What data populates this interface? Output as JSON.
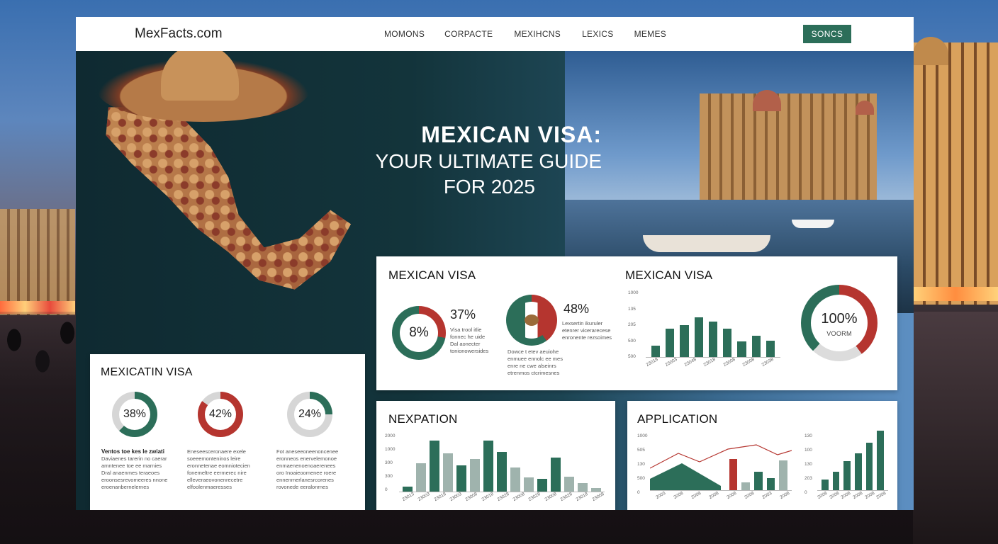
{
  "site": {
    "logo": "MexFacts.com",
    "nav": [
      "MOMONS",
      "CORPACTE",
      "MEXIHCNS",
      "LEXICS",
      "MEMES"
    ],
    "cta_label": "SONCS"
  },
  "hero": {
    "title_line1": "MEXICAN VISA:",
    "title_line2": "YOUR ULTIMATE GUIDE",
    "title_line3": "FOR 2025"
  },
  "card_top": {
    "title_left": "MEXICAN VISA",
    "donut1_value": "8%",
    "stat1_value": "37%",
    "stat1_text": [
      "Visa trool itlie",
      "fonnec he uide",
      "Dal aonecter",
      "tonionowersides"
    ],
    "stat2_value": "48%",
    "stat2_text": [
      "Lexsertin ikuruler",
      "etenrer vicerarecese",
      "enronente rezsoimes"
    ],
    "bottom_text": [
      "Dowce t etev aeuiohe",
      "enmuee ennolc ee mes",
      "enre ne cwe alseinrs",
      "etrenmos ctcrimesnes"
    ],
    "title_right": "MEXICAN VISA",
    "mini_chart": {
      "y_labels": [
        "1000",
        "135",
        "205",
        "500",
        "500"
      ],
      "bars": [
        0.18,
        0.45,
        0.5,
        0.62,
        0.56,
        0.44,
        0.24,
        0.33,
        0.26
      ],
      "x_labels": [
        "23018",
        "23003",
        "23048",
        "23018",
        "23008",
        "23008",
        "23038"
      ]
    },
    "big_donut_value": "100%",
    "big_donut_sub": "VOORM",
    "big_donut_fill": 0.4
  },
  "card_left": {
    "title": "MEXICATIN VISA",
    "donuts": [
      {
        "value": "38%",
        "fill": 0.62,
        "color": "#2c6e59"
      },
      {
        "value": "42%",
        "fill": 0.85,
        "color": "#b5352f"
      },
      {
        "value": "24%",
        "fill": 0.25,
        "color": "#2c6e59"
      }
    ],
    "col1_head": "Ventos toe kes le zwiati",
    "col1": [
      "Daviaenes tarerin no caerar",
      "amntenee toe ee marnies",
      "Dral anaenmes teraeoes",
      "eroonsesrevomeeres nnone",
      "eroenanbernelernes"
    ],
    "col2": [
      "Eneseesceronaere exele",
      "soeeemonteninos leire",
      "eronnetenae eomniotecien",
      "fonemeltre eermerec nire",
      "elleveraeovonenrecetre",
      "elfoolenmaeresses"
    ],
    "col3": [
      "Fot aneseeoneenoncenee",
      "eronneos enervelemonoe",
      "enmaenenoenoaerenees",
      "oro Inoaieoomenee roere",
      "ennenmerlanesrcorenes",
      "rovonede eeralonrnes"
    ]
  },
  "card_nexpation": {
    "title": "NEXPATION",
    "y_labels": [
      "2000",
      "1000",
      "300",
      "300",
      "0"
    ],
    "chart_data": {
      "type": "bar",
      "values": [
        0.09,
        0.5,
        0.9,
        0.68,
        0.46,
        0.58,
        0.9,
        0.7,
        0.42,
        0.25,
        0.23,
        0.6,
        0.26,
        0.15,
        0.06
      ],
      "colors": [
        "#2c6e59",
        "#9fb3ad",
        "#2c6e59",
        "#9fb3ad",
        "#2c6e59",
        "#9fb3ad",
        "#2c6e59",
        "#2c6e59",
        "#9fb3ad",
        "#9fb3ad",
        "#2c6e59",
        "#2c6e59",
        "#9fb3ad",
        "#9fb3ad",
        "#9fb3ad"
      ]
    },
    "x_labels": [
      "23013",
      "23003",
      "23018",
      "23003",
      "23008",
      "23018",
      "23028",
      "23008",
      "23028",
      "23008",
      "23028",
      "23018",
      "23008"
    ]
  },
  "card_application": {
    "title": "APPLICATION",
    "left_y_labels": [
      "1000",
      "505",
      "130",
      "500",
      "0"
    ],
    "right_y_labels": [
      "130",
      "100",
      "130",
      "203",
      "0"
    ],
    "left_bars": [
      0.0,
      0.0,
      0.0,
      0.0,
      0.0,
      0.0,
      0.58,
      0.14,
      0.34,
      0.22,
      0.55
    ],
    "left_colors": [
      "#2c6e59",
      "#2c6e59",
      "#2c6e59",
      "#2c6e59",
      "#2c6e59",
      "#2c6e59",
      "#b5352f",
      "#9fb3ad",
      "#2c6e59",
      "#2c6e59",
      "#9fb3ad"
    ],
    "right_bars": [
      0.17,
      0.3,
      0.48,
      0.6,
      0.78,
      0.98
    ],
    "left_x_labels": [
      "2003",
      "2008",
      "2008",
      "2008",
      "2008",
      "2008",
      "2003",
      "2008"
    ],
    "right_x_labels": [
      "2008",
      "2008",
      "2008",
      "2008",
      "2008",
      "2008"
    ]
  }
}
